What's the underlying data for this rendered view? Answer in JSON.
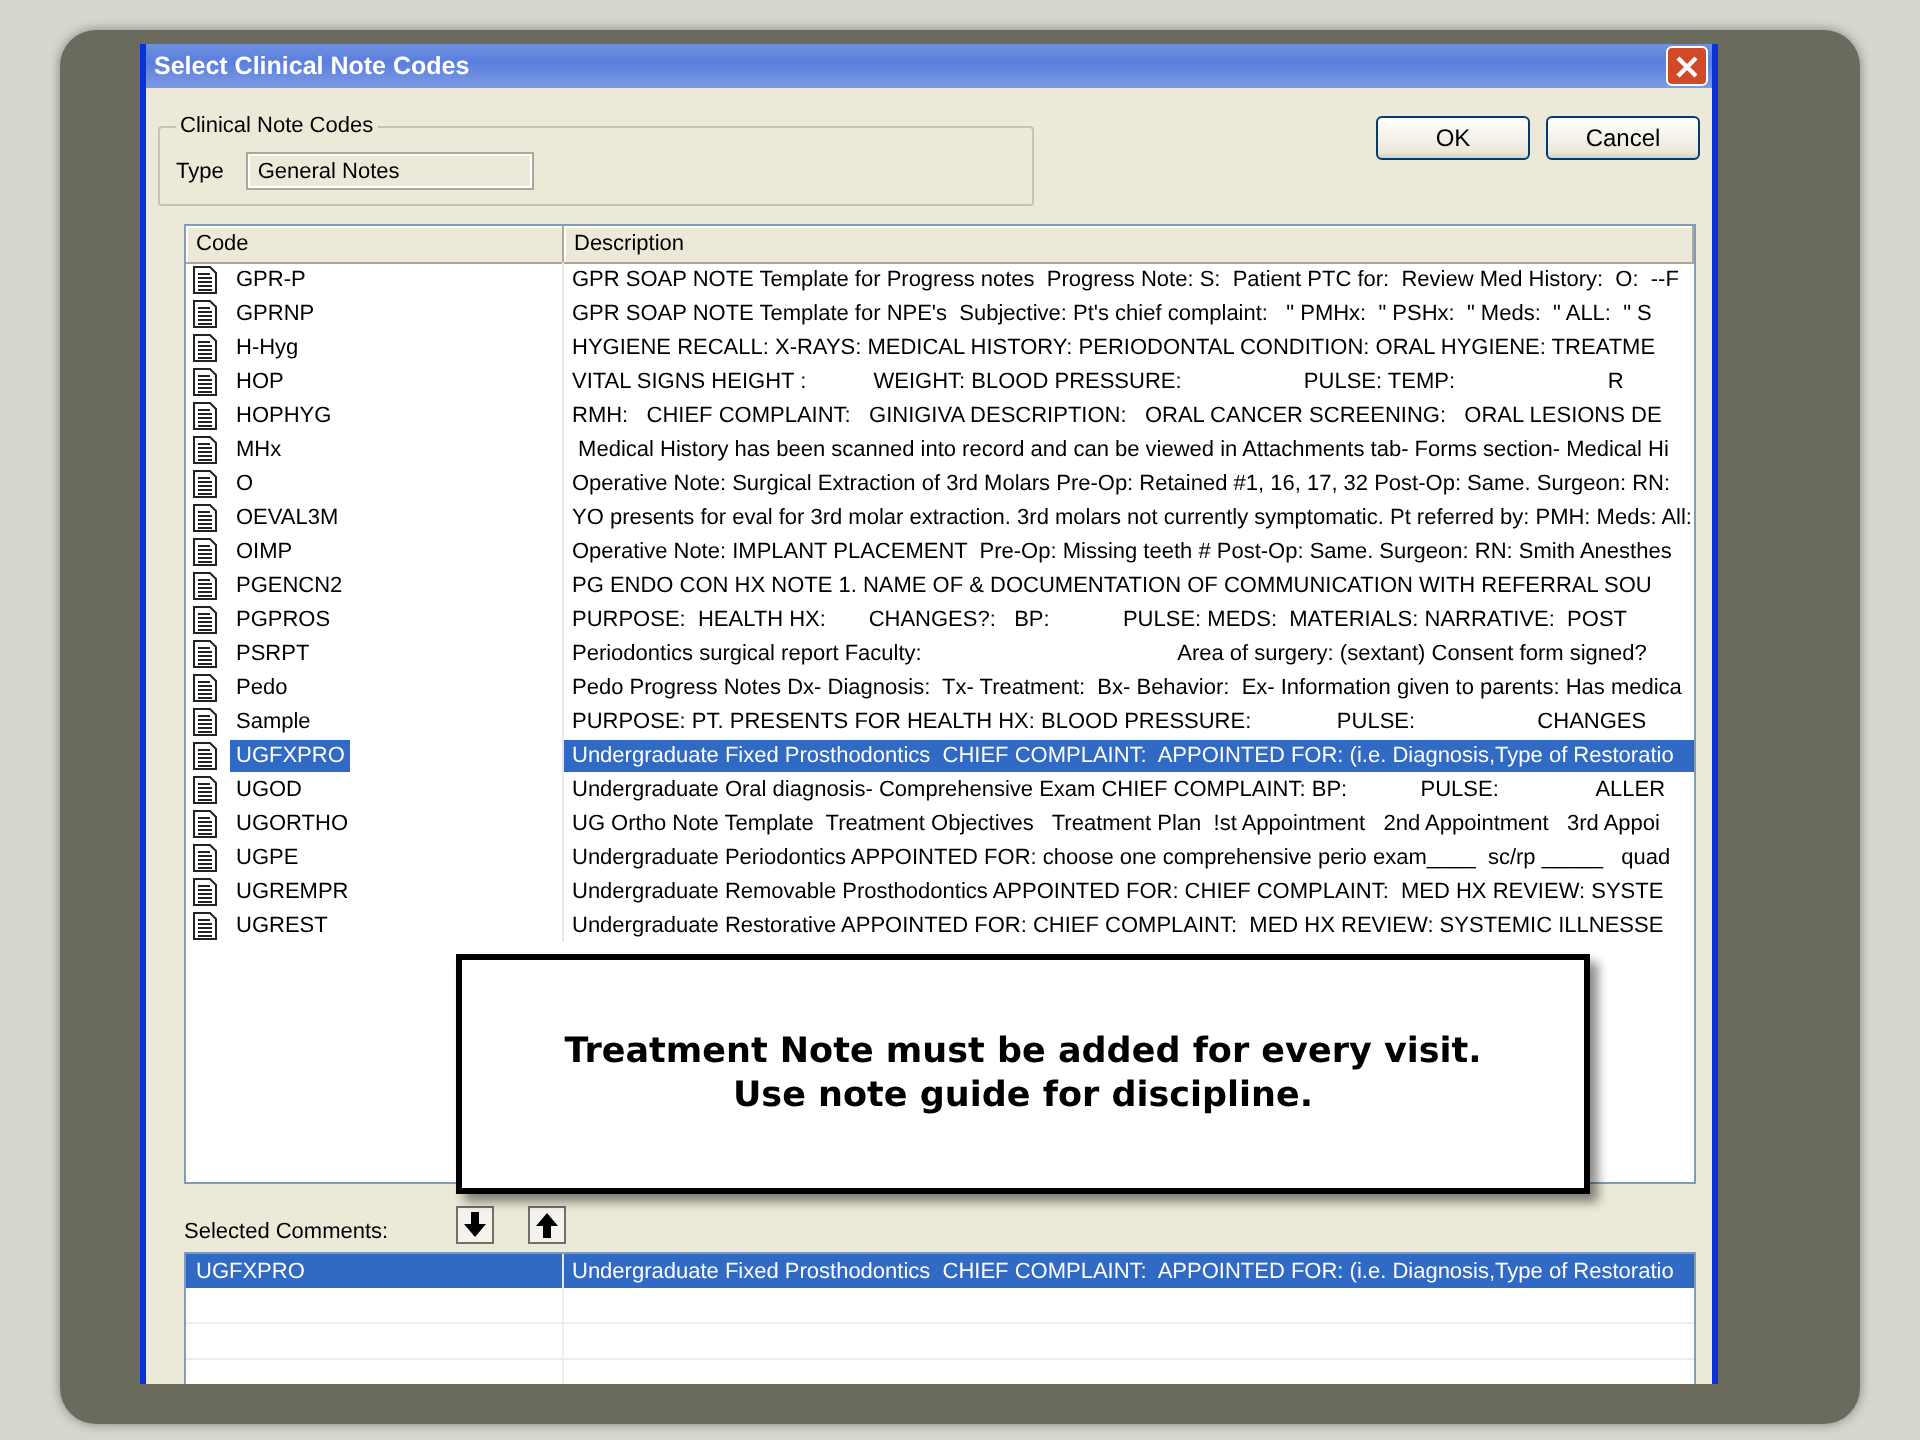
{
  "dialog": {
    "title": "Select Clinical Note Codes",
    "group": {
      "label": "Clinical Note Codes",
      "type_label": "Type",
      "type_value": "General Notes"
    },
    "buttons": [
      "OK",
      "Cancel"
    ],
    "codes_table": {
      "columns": [
        "Code",
        "Description"
      ],
      "rows": [
        {
          "code": "GPR-P",
          "description": "GPR SOAP NOTE Template for Progress notes  Progress Note: S:  Patient PTC for:  Review Med History:  O:  --F",
          "selected": false
        },
        {
          "code": "GPRNP",
          "description": "GPR SOAP NOTE Template for NPE's  Subjective: Pt's chief complaint:   \" PMHx:  \" PSHx:  \" Meds:  \" ALL:  \" S",
          "selected": false
        },
        {
          "code": "H-Hyg",
          "description": "HYGIENE RECALL: X-RAYS: MEDICAL HISTORY: PERIODONTAL CONDITION: ORAL HYGIENE: TREATME",
          "selected": false
        },
        {
          "code": "HOP",
          "description": "VITAL SIGNS HEIGHT :           WEIGHT: BLOOD PRESSURE:                    PULSE: TEMP:                         R",
          "selected": false
        },
        {
          "code": "HOPHYG",
          "description": "RMH:   CHIEF COMPLAINT:   GINIGIVA DESCRIPTION:   ORAL CANCER SCREENING:   ORAL LESIONS DE",
          "selected": false
        },
        {
          "code": "MHx",
          "description": " Medical History has been scanned into record and can be viewed in Attachments tab- Forms section- Medical Hi",
          "selected": false
        },
        {
          "code": "O",
          "description": "Operative Note: Surgical Extraction of 3rd Molars Pre-Op: Retained #1, 16, 17, 32 Post-Op: Same. Surgeon: RN:",
          "selected": false
        },
        {
          "code": "OEVAL3M",
          "description": "YO presents for eval for 3rd molar extraction. 3rd molars not currently symptomatic. Pt referred by: PMH: Meds: All:",
          "selected": false
        },
        {
          "code": "OIMP",
          "description": "Operative Note: IMPLANT PLACEMENT  Pre-Op: Missing teeth # Post-Op: Same. Surgeon: RN: Smith Anesthes",
          "selected": false
        },
        {
          "code": "PGENCN2",
          "description": "PG ENDO CON HX NOTE 1. NAME OF & DOCUMENTATION OF COMMUNICATION WITH REFERRAL SOU",
          "selected": false
        },
        {
          "code": "PGPROS",
          "description": "PURPOSE:  HEALTH HX:       CHANGES?:   BP:            PULSE: MEDS:  MATERIALS: NARRATIVE:  POST",
          "selected": false
        },
        {
          "code": "PSRPT",
          "description": "Periodontics surgical report Faculty:                                          Area of surgery: (sextant) Consent form signed?",
          "selected": false
        },
        {
          "code": "Pedo",
          "description": "Pedo Progress Notes Dx- Diagnosis:  Tx- Treatment:  Bx- Behavior:  Ex- Information given to parents: Has medica",
          "selected": false
        },
        {
          "code": "Sample",
          "description": "PURPOSE: PT. PRESENTS FOR HEALTH HX: BLOOD PRESSURE:              PULSE:                    CHANGES",
          "selected": false
        },
        {
          "code": "UGFXPRO",
          "description": "Undergraduate Fixed Prosthodontics  CHIEF COMPLAINT:  APPOINTED FOR: (i.e. Diagnosis,Type of Restoratio",
          "selected": true
        },
        {
          "code": "UGOD",
          "description": "Undergraduate Oral diagnosis- Comprehensive Exam CHIEF COMPLAINT: BP:            PULSE:                ALLER",
          "selected": false
        },
        {
          "code": "UGORTHO",
          "description": "UG Ortho Note Template  Treatment Objectives   Treatment Plan  !st Appointment   2nd Appointment   3rd Appoi",
          "selected": false
        },
        {
          "code": "UGPE",
          "description": "Undergraduate Periodontics APPOINTED FOR: choose one comprehensive perio exam____  sc/rp _____   quad",
          "selected": false
        },
        {
          "code": "UGREMPR",
          "description": "Undergraduate Removable Prosthodontics APPOINTED FOR: CHIEF COMPLAINT:  MED HX REVIEW: SYSTE",
          "selected": false
        },
        {
          "code": "UGREST",
          "description": "Undergraduate Restorative APPOINTED FOR: CHIEF COMPLAINT:  MED HX REVIEW: SYSTEMIC ILLNESSE",
          "selected": false
        }
      ]
    },
    "callout": {
      "lines": [
        "Treatment Note must be added for every visit.",
        "Use note guide for discipline."
      ]
    },
    "selected_comments": {
      "label": "Selected Comments:",
      "rows": [
        {
          "code": "UGFXPRO",
          "description": "Undergraduate Fixed Prosthodontics  CHIEF COMPLAINT:  APPOINTED FOR: (i.e. Diagnosis,Type of Restoratio",
          "selected": true
        }
      ]
    }
  }
}
